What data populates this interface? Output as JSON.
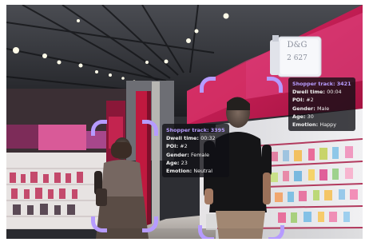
{
  "billboard": {
    "brand": "D&G",
    "model": "2 627"
  },
  "shoppers": [
    {
      "title": "Shopper track: 3395",
      "fields": [
        {
          "label": "Dwell time:",
          "value": "00:32"
        },
        {
          "label": "POI:",
          "value": "#2"
        },
        {
          "label": "Gender:",
          "value": "Female"
        },
        {
          "label": "Age:",
          "value": "23"
        },
        {
          "label": "Emotion:",
          "value": "Neutral"
        }
      ]
    },
    {
      "title": "Shopper track: 3421",
      "fields": [
        {
          "label": "Dwell time:",
          "value": "00:04"
        },
        {
          "label": "POI:",
          "value": "#2"
        },
        {
          "label": "Gender:",
          "value": "Male"
        },
        {
          "label": "Age:",
          "value": "30"
        },
        {
          "label": "Emotion:",
          "value": "Happy"
        }
      ]
    }
  ],
  "colors": {
    "tracking_frame": "#b69bff",
    "track_title": "#b79cff",
    "store_accent": "#d8174e"
  }
}
